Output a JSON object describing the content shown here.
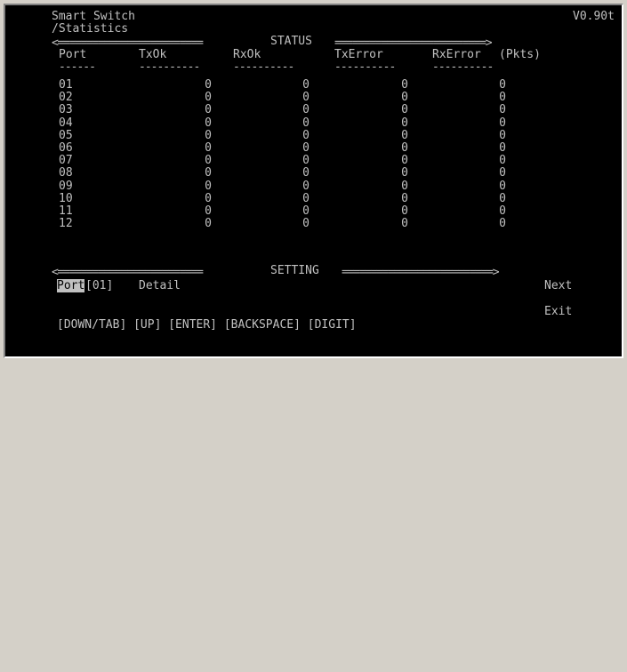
{
  "header": {
    "title": "Smart Switch",
    "version": "V0.90t",
    "path": "/Statistics"
  },
  "status_section": {
    "divider_left": "<=========================",
    "label": "STATUS",
    "divider_right": "==========================>",
    "columns": [
      "Port",
      "TxOk",
      "RxOk",
      "TxError",
      "RxError",
      "(Pkts)"
    ],
    "underlines": [
      "------",
      "----------",
      "----------",
      "----------",
      "----------"
    ],
    "rows": [
      {
        "port": "01",
        "tx_ok": "0",
        "rx_ok": "0",
        "tx_error": "0",
        "rx_error": "0"
      },
      {
        "port": "02",
        "tx_ok": "0",
        "rx_ok": "0",
        "tx_error": "0",
        "rx_error": "0"
      },
      {
        "port": "03",
        "tx_ok": "0",
        "rx_ok": "0",
        "tx_error": "0",
        "rx_error": "0"
      },
      {
        "port": "04",
        "tx_ok": "0",
        "rx_ok": "0",
        "tx_error": "0",
        "rx_error": "0"
      },
      {
        "port": "05",
        "tx_ok": "0",
        "rx_ok": "0",
        "tx_error": "0",
        "rx_error": "0"
      },
      {
        "port": "06",
        "tx_ok": "0",
        "rx_ok": "0",
        "tx_error": "0",
        "rx_error": "0"
      },
      {
        "port": "07",
        "tx_ok": "0",
        "rx_ok": "0",
        "tx_error": "0",
        "rx_error": "0"
      },
      {
        "port": "08",
        "tx_ok": "0",
        "rx_ok": "0",
        "tx_error": "0",
        "rx_error": "0"
      },
      {
        "port": "09",
        "tx_ok": "0",
        "rx_ok": "0",
        "tx_error": "0",
        "rx_error": "0"
      },
      {
        "port": "10",
        "tx_ok": "0",
        "rx_ok": "0",
        "tx_error": "0",
        "rx_error": "0"
      },
      {
        "port": "11",
        "tx_ok": "0",
        "rx_ok": "0",
        "tx_error": "0",
        "rx_error": "0"
      },
      {
        "port": "12",
        "tx_ok": "0",
        "rx_ok": "0",
        "tx_error": "0",
        "rx_error": "0"
      }
    ]
  },
  "setting_section": {
    "divider_left": "<=========================",
    "label": "SETTING",
    "divider_right": "==========================>",
    "port_label": "Port",
    "port_value": "[01]",
    "detail_label": "Detail",
    "next_label": "Next",
    "exit_label": "Exit"
  },
  "keys_help": "[DOWN/TAB] [UP] [ENTER] [BACKSPACE] [DIGIT]",
  "colors": {
    "screen_bg": "#000000",
    "text": "#c0c0c0",
    "window_frame": "#d4d0c8"
  }
}
